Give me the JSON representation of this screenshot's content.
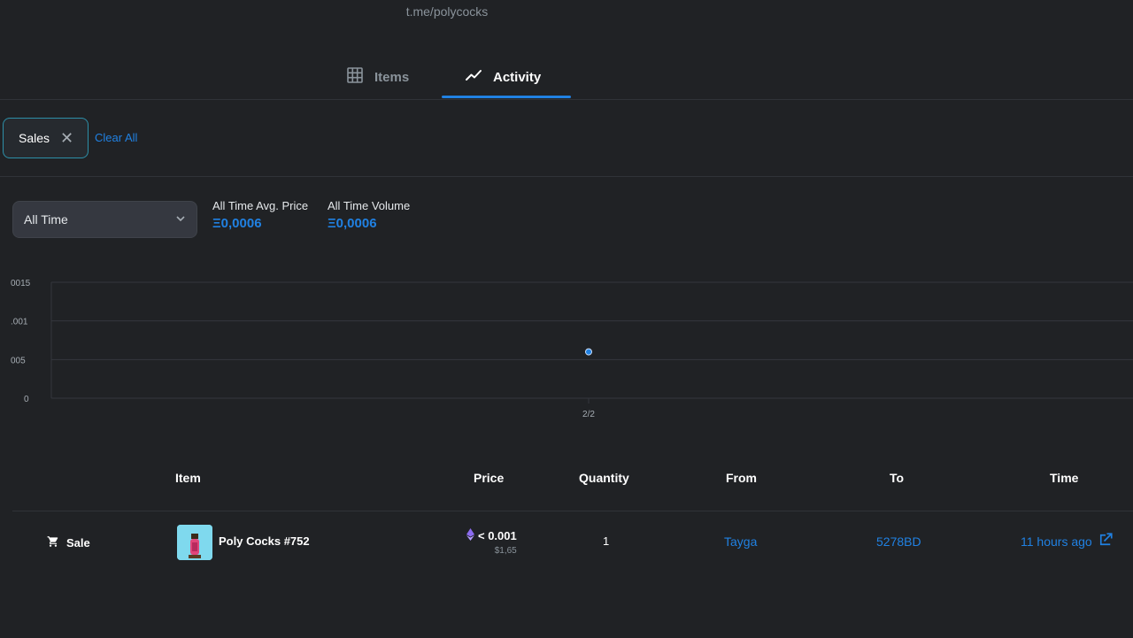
{
  "header": {
    "link_text": "t.me/polycocks"
  },
  "tabs": [
    {
      "label": "Items",
      "icon": "grid-icon",
      "active": false
    },
    {
      "label": "Activity",
      "icon": "trending-icon",
      "active": true
    }
  ],
  "filters": {
    "chips": [
      {
        "label": "Sales"
      }
    ],
    "clear_all_label": "Clear All"
  },
  "time_select": {
    "selected": "All Time"
  },
  "stats": {
    "avg_price_label": "All Time Avg. Price",
    "avg_price_value": "Ξ0,0006",
    "volume_label": "All Time Volume",
    "volume_value": "Ξ0,0006"
  },
  "chart_data": {
    "type": "scatter",
    "x": [
      "2/2"
    ],
    "values": [
      0.0006
    ],
    "ytick_labels": [
      "0015",
      ".001",
      "005",
      "0"
    ],
    "ylim": [
      0,
      0.0015
    ],
    "grid": true,
    "point_color": "#2081e2"
  },
  "table": {
    "headers": {
      "item": "Item",
      "price": "Price",
      "quantity": "Quantity",
      "from": "From",
      "to": "To",
      "time": "Time"
    },
    "rows": [
      {
        "event": "Sale",
        "event_icon": "cart-icon",
        "item_name": "Poly Cocks #752",
        "price": "< 0.001",
        "price_usd": "$1,65",
        "quantity": "1",
        "from": "Tayga",
        "to": "5278BD",
        "time": "11 hours ago"
      }
    ]
  },
  "colors": {
    "accent": "#2081e2",
    "background": "#202225",
    "chip_border": "#2d8fa8"
  }
}
